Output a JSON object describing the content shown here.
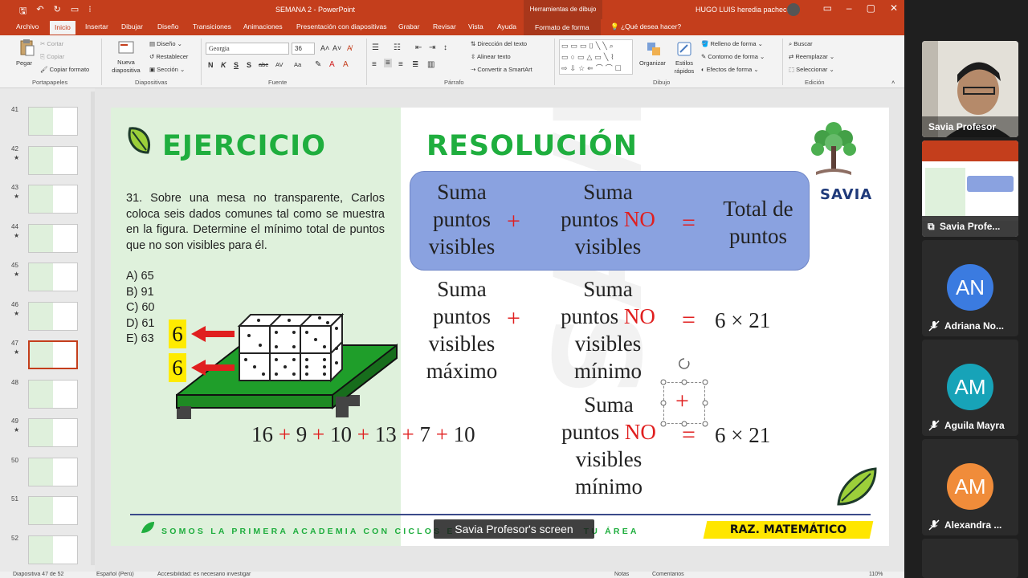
{
  "window": {
    "doc_title": "SEMANA 2  -  PowerPoint",
    "context_title": "Herramientas de dibujo",
    "user": "HUGO LUIS heredia pacheco"
  },
  "tabs": [
    "Archivo",
    "Inicio",
    "Insertar",
    "Dibujar",
    "Diseño",
    "Transiciones",
    "Animaciones",
    "Presentación con diapositivas",
    "Grabar",
    "Revisar",
    "Vista",
    "Ayuda",
    "Formato de forma",
    "¿Qué desea hacer?"
  ],
  "ribbon": {
    "portapapeles": {
      "paste": "Pegar",
      "cut": "Cortar",
      "copy": "Copiar",
      "format": "Copiar formato",
      "label": "Portapapeles"
    },
    "diapositivas": {
      "new": "Nueva diapositiva",
      "layout": "Diseño",
      "reset": "Restablecer",
      "section": "Sección",
      "label": "Diapositivas"
    },
    "fuente": {
      "font": "Georgia",
      "size": "36",
      "label": "Fuente",
      "buttons": [
        "N",
        "K",
        "S",
        "S",
        "abc",
        "AV",
        "Aa"
      ]
    },
    "parrafo": {
      "dir": "Dirección del texto",
      "align": "Alinear texto",
      "smartart": "Convertir a SmartArt",
      "label": "Párrafo"
    },
    "dibujo": {
      "arrange": "Organizar",
      "styles": "Estilos rápidos",
      "fill": "Relleno de forma",
      "outline": "Contorno de forma",
      "effects": "Efectos de forma",
      "label": "Dibujo"
    },
    "edicion": {
      "find": "Buscar",
      "replace": "Reemplazar",
      "select": "Seleccionar",
      "label": "Edición"
    }
  },
  "thumbnails": [
    {
      "num": "41",
      "star": false
    },
    {
      "num": "42",
      "star": true
    },
    {
      "num": "43",
      "star": true
    },
    {
      "num": "44",
      "star": true
    },
    {
      "num": "45",
      "star": true
    },
    {
      "num": "46",
      "star": true
    },
    {
      "num": "47",
      "star": true,
      "active": true
    },
    {
      "num": "48",
      "star": false
    },
    {
      "num": "49",
      "star": true
    },
    {
      "num": "50",
      "star": false
    },
    {
      "num": "51",
      "star": false
    },
    {
      "num": "52",
      "star": false
    }
  ],
  "slide": {
    "ejercicio": "EJERCICIO",
    "resolucion": "RESOLUCIÓN",
    "problem": "31. Sobre una mesa no transparente, Carlos coloca seis dados comunes tal como se muestra en la figura. Determine el mínimo total de puntos que no son visibles para él.",
    "options": [
      "A) 65",
      "B) 91",
      "C) 60",
      "D) 61",
      "E) 63"
    ],
    "six_top": "6",
    "six_bottom": "6",
    "row1": {
      "a": [
        "Suma",
        "puntos",
        "visibles"
      ],
      "b_pre": [
        "Suma"
      ],
      "b_mid_pre": "puntos ",
      "b_mid_red": "NO",
      "b_post": [
        "visibles"
      ],
      "c": [
        "Total de",
        "puntos"
      ]
    },
    "row2": {
      "a": [
        "Suma",
        "puntos",
        "visibles",
        "máximo"
      ],
      "b1": "Suma",
      "b2_pre": "puntos ",
      "b2_red": "NO",
      "b3": "visibles",
      "b4": "mínimo",
      "result": "6 × 21"
    },
    "row3": {
      "b1": "Suma",
      "b2_pre": "puntos ",
      "b2_red": "NO",
      "b3": "visibles",
      "b4": "mínimo",
      "result": "6 × 21"
    },
    "sum_terms": [
      "16",
      "9",
      "10",
      "13",
      "7",
      "10"
    ],
    "plus": "+",
    "equals": "=",
    "brand": "SAVIA",
    "slogan_left": "SOMOS LA PRIMERA ACADEMIA CON CICLOS E",
    "slogan_right": "TU ÁREA",
    "subject": "RAZ. MATEMÁTICO"
  },
  "caption": "Savia Profesor's screen",
  "statusbar": {
    "slide": "Diapositiva 47 de 52",
    "lang": "Español (Perú)",
    "access": "Accesibilidad: es necesario investigar",
    "notes": "Notas",
    "comments": "Comentarios",
    "zoom": "110%"
  },
  "participants": [
    {
      "name": "Savia Profesor",
      "type": "video"
    },
    {
      "name": "Savia Profe...",
      "type": "screen"
    },
    {
      "name": "Adriana No...",
      "initials": "AN",
      "color": "#3b7be0"
    },
    {
      "name": "Aguila Mayra",
      "initials": "AM",
      "color": "#17a3b8"
    },
    {
      "name": "Alexandra ...",
      "initials": "AM",
      "color": "#f08c3a"
    }
  ]
}
